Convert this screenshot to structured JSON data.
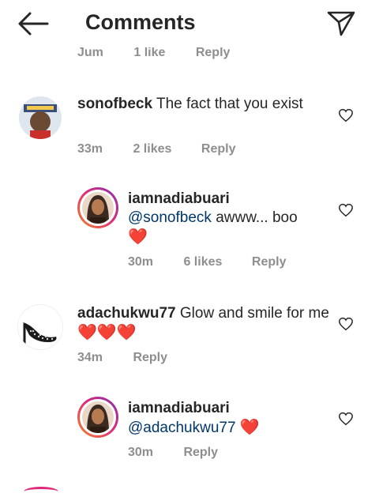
{
  "header": {
    "title": "Comments"
  },
  "cut_row": {
    "time": "Jum",
    "likes": "1 like",
    "reply": "Reply"
  },
  "comments": [
    {
      "username": "sonofbeck",
      "text": "The fact that you exist",
      "time": "33m",
      "likes": "2 likes",
      "reply": "Reply"
    },
    {
      "username": "iamnadiabuari",
      "mention": "@sonofbeck",
      "text": "awww... boo",
      "emoji": "❤️",
      "time": "30m",
      "likes": "6 likes",
      "reply": "Reply"
    },
    {
      "username": "adachukwu77",
      "text": "Glow and smile for me",
      "emoji": "❤️❤️❤️",
      "time": "34m",
      "reply": "Reply"
    },
    {
      "username": "iamnadiabuari",
      "mention": "@adachukwu77",
      "emoji": "❤️",
      "time": "30m",
      "reply": "Reply"
    }
  ],
  "colors": {
    "primary_text": "#262626",
    "secondary_text": "#8e8e8e",
    "mention": "#00376b",
    "heart_red": "#ed1c24"
  }
}
